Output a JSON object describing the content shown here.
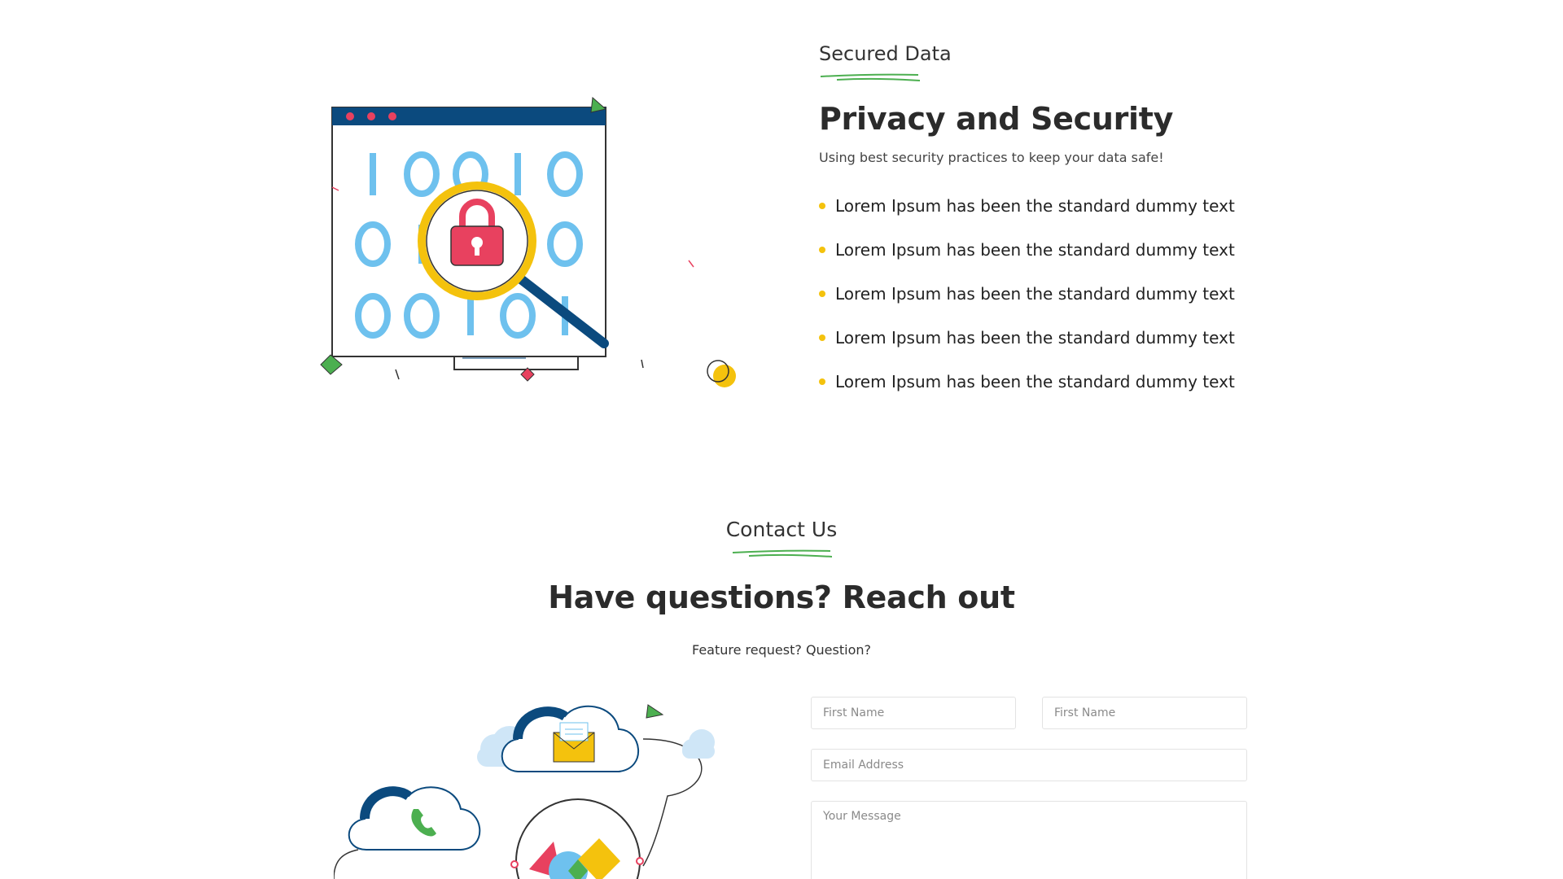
{
  "privacy": {
    "eyebrow": "Secured Data",
    "title": "Privacy and Security",
    "subtitle": "Using best security practices to keep your data safe!",
    "features": [
      "Lorem Ipsum has been the standard dummy text",
      "Lorem Ipsum has been the standard dummy text",
      "Lorem Ipsum has been the standard dummy text",
      "Lorem Ipsum has been the standard dummy text",
      "Lorem Ipsum has been the standard dummy text"
    ],
    "illustration": {
      "binary_rows": [
        "10010",
        "0  10",
        "00101"
      ],
      "icons": [
        "browser-window-icon",
        "magnifier-icon",
        "padlock-icon",
        "document-icon"
      ]
    }
  },
  "contact": {
    "eyebrow": "Contact Us",
    "title": "Have questions? Reach out",
    "subtitle": "Feature request? Question?",
    "form": {
      "first_name_placeholder": "First Name",
      "last_name_placeholder": "First Name",
      "email_placeholder": "Email Address",
      "message_placeholder": "Your Message"
    },
    "illustration": {
      "icons": [
        "cloud-envelope-icon",
        "cloud-phone-icon",
        "shapes-globe-icon"
      ]
    }
  },
  "colors": {
    "accent_green": "#4caf50",
    "accent_yellow": "#f4c20d",
    "navy": "#0b4a7e",
    "binary_blue": "#6ec1ee",
    "lock_red": "#e8415f"
  }
}
